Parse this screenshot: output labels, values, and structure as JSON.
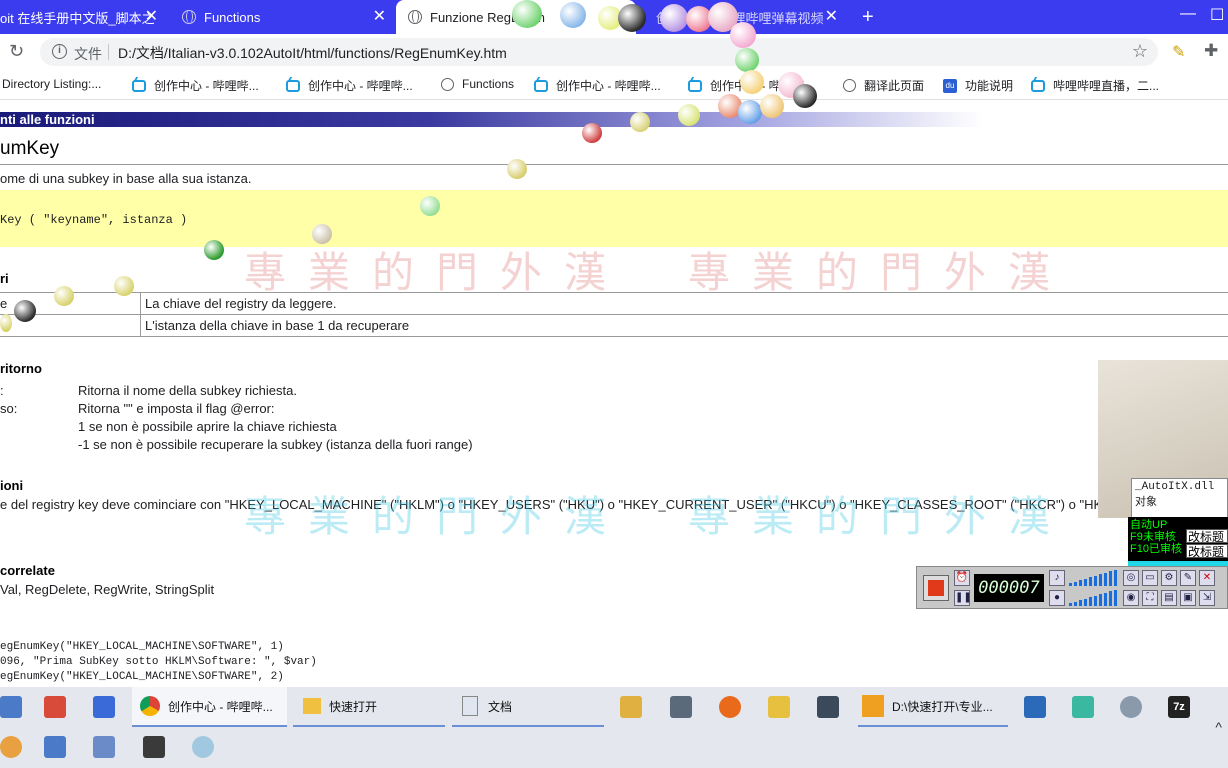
{
  "browser": {
    "tabs": [
      {
        "title": "oit 在线手册中文版_脚本之",
        "active": false
      },
      {
        "title": "Functions",
        "active": false
      },
      {
        "title": "Funzione RegEnum",
        "active": true
      },
      {
        "title": "创作中心 - 哔哩哔哩弹幕视频",
        "active": false
      }
    ],
    "new_tab": "+",
    "window_controls": {
      "minimize": "—",
      "maximize": "☐"
    },
    "address": {
      "label": "文件",
      "url": "D:/文档/Italian-v3.0.102AutoIt/html/functions/RegEnumKey.htm"
    },
    "bookmarks": [
      {
        "label": "Directory Listing:...",
        "icon": "none"
      },
      {
        "label": "创作中心 - 哔哩哔...",
        "icon": "bilibili-icon"
      },
      {
        "label": "创作中心 - 哔哩哔...",
        "icon": "bilibili-icon"
      },
      {
        "label": "Functions",
        "icon": "globe-icon"
      },
      {
        "label": "创作中心 - 哔哩哔...",
        "icon": "bilibili-icon"
      },
      {
        "label": "创作中心 - 哔哩哔...",
        "icon": "bilibili-icon"
      },
      {
        "label": "翻译此页面",
        "icon": "globe-icon"
      },
      {
        "label": "功能说明",
        "icon": "baidu-icon"
      },
      {
        "label": "哔哩哔哩直播，二...",
        "icon": "bilibili-icon"
      }
    ]
  },
  "doc": {
    "nav_banner": "nti alle funzioni",
    "title": "umKey",
    "description": "ome di una subkey in base alla sua istanza.",
    "syntax": "Key ( \"keyname\", istanza )",
    "params_heading": "ri",
    "params": [
      {
        "name": "e",
        "desc": "La chiave del registry da leggere."
      },
      {
        "name": "",
        "desc": "L'istanza della chiave in base 1 da recuperare"
      }
    ],
    "return_heading": "ritorno",
    "return_rows": [
      {
        "label": ":",
        "text": "Ritorna il nome della subkey richiesta."
      },
      {
        "label": "so:",
        "text": "Ritorna \"\" e imposta il flag @error:"
      },
      {
        "label": "",
        "text": "1 se non è possibile aprire la chiave richiesta"
      },
      {
        "label": "",
        "text": "-1 se non è possibile recuperare la subkey (istanza della fuori range)"
      }
    ],
    "remarks_heading": "ioni",
    "remarks_text": "e del registry key deve cominciare con \"HKEY_LOCAL_MACHINE\" (\"HKLM\") o \"HKEY_USERS\" (\"HKU\") o \"HKEY_CURRENT_USER\" (\"HKCU\") o \"HKEY_CLASSES_ROOT\" (\"HKCR\") o \"HKEY",
    "related_heading": "correlate",
    "related_text": "Val, RegDelete, RegWrite, StringSplit",
    "code_lines": [
      "egEnumKey(\"HKEY_LOCAL_MACHINE\\SOFTWARE\", 1)",
      "096, \"Prima SubKey sotto HKLM\\Software: \", $var)",
      "egEnumKey(\"HKEY_LOCAL_MACHINE\\SOFTWARE\", 2)"
    ]
  },
  "watermark": {
    "text": "專業的門外漢"
  },
  "overlays": {
    "dll_label": "_AutoItX.dll对象",
    "status_lines": [
      "自动UP",
      "F9未审核",
      "F10已审核"
    ],
    "gaibiao_1": "改标题",
    "gaibiao_2": "改标题",
    "recorder_time": "000007"
  },
  "taskbar": {
    "items": [
      {
        "label": "创作中心 - 哔哩哔...",
        "running": true
      },
      {
        "label": "快速打开",
        "running": true
      },
      {
        "label": "文档",
        "running": true
      },
      {
        "label": "D:\\快速打开\\专业...",
        "running": true
      }
    ],
    "tray_up": "^"
  },
  "colors": {
    "tabstrip": "#3b3bef",
    "syntax_bg": "#ffffa8",
    "banner_dark": "#1a1a7a",
    "recorder_red": "#e03a1a"
  }
}
